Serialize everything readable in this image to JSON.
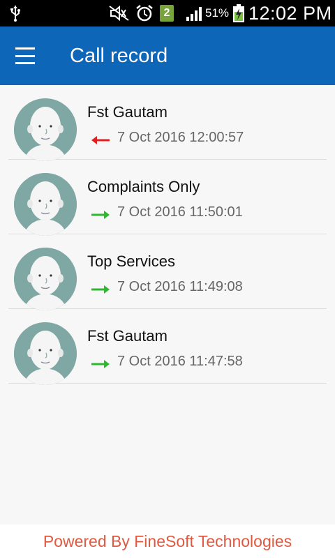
{
  "status_bar": {
    "battery_percent": "51%",
    "sim_badge": "2",
    "time": "12:02 PM",
    "icons": [
      "usb-icon",
      "mute-icon",
      "alarm-icon",
      "sim-icon",
      "signal-icon",
      "battery-charging-icon"
    ]
  },
  "app_bar": {
    "title": "Call record",
    "menu_icon": "hamburger-menu-icon",
    "background": "#0d66b8"
  },
  "calls": [
    {
      "name": "Fst Gautam",
      "datetime": "7 Oct 2016 12:00:57",
      "direction": "incoming",
      "arrow_color": "#e02020"
    },
    {
      "name": "Complaints Only",
      "datetime": "7 Oct 2016 11:50:01",
      "direction": "outgoing",
      "arrow_color": "#2db82d"
    },
    {
      "name": "Top Services",
      "datetime": "7 Oct 2016 11:49:08",
      "direction": "outgoing",
      "arrow_color": "#2db82d"
    },
    {
      "name": "Fst Gautam",
      "datetime": "7 Oct 2016 11:47:58",
      "direction": "outgoing",
      "arrow_color": "#2db82d"
    }
  ],
  "footer": {
    "text": "Powered By FineSoft Technologies",
    "color": "#e05a42"
  }
}
